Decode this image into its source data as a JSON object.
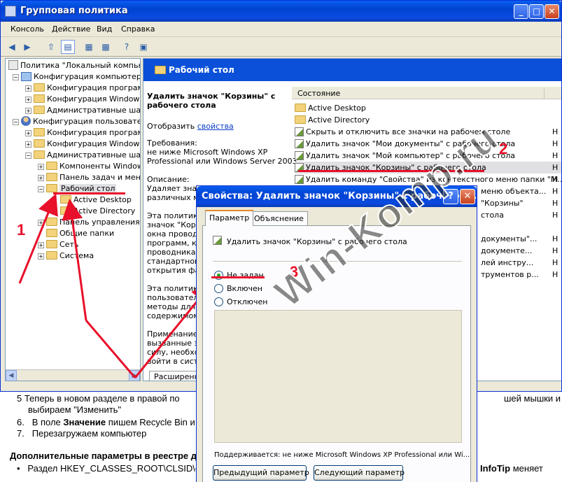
{
  "window": {
    "title": "Групповая политика",
    "menu": [
      "Консоль",
      "Действие",
      "Вид",
      "Справка"
    ],
    "controls": {
      "minimize": "_",
      "maximize": "□",
      "close": "✕"
    }
  },
  "tree": {
    "root": "Политика \"Локальный компьюте",
    "computer_config": "Конфигурация компьютера",
    "computer_children": [
      "Конфигурация программ",
      "Конфигурация Windows",
      "Административные шабл"
    ],
    "user_config": "Конфигурация пользователя",
    "user_children": [
      "Конфигурация программ",
      "Конфигурация Windows",
      "Административные шабл"
    ],
    "admin_children": [
      "Компоненты Windows",
      "Панель задач и меню",
      "Рабочий стол"
    ],
    "desktop_children": [
      "Active Desktop",
      "Active Directory"
    ],
    "admin_rest": [
      "Панель управления",
      "Общие папки",
      "Сеть",
      "Система"
    ]
  },
  "right": {
    "header": "Рабочий стол",
    "desc_title_1": "Удалить значок \"Корзины\" с",
    "desc_title_2": "рабочего стола",
    "show_prefix": "Отобразить",
    "show_link": "свойства",
    "req_label": "Требования:",
    "req_1": "не ниже Microsoft Windows XP",
    "req_2": "Professional или Windows Server 2003",
    "desc_label": "Описание:",
    "desc_1": "Удаляет значок",
    "desc_2": "различных ме",
    "p3_1": "Эта политика",
    "p3_2": "значок \"Корзи",
    "p3_3": "окна проводни",
    "p3_4": "программ, кот",
    "p3_5": "проводника W",
    "p3_6": "стандартного",
    "p3_7": "открытия фай",
    "p4_1": "Эта политика",
    "p4_2": "пользователя",
    "p4_3": "методы для п",
    "p4_4": "содержимому",
    "p5_1": "Применание: ч",
    "p5_2": "вызванные эт",
    "p5_3": "силу, необхо",
    "p5_4": "войти в систе",
    "col_state": "Состояние",
    "folders": [
      "Active Desktop",
      "Active Directory"
    ],
    "policies": [
      "Скрыть и отключить все значки на рабочем столе",
      "Удалить значок \"Мои документы\" с рабочего стола",
      "Удалить значок \"Мой компьютер\" с рабочего стола",
      "Удалить значок \"Корзины\" с рабочего стола",
      "Удалить команду \"Свойства\" из контекстного меню папки \"М..."
    ],
    "state_h": "Н",
    "bottom_tab": "Расширенный",
    "behind_rows": [
      "меню объекта...",
      "\"Корзины\"",
      "стола",
      "документы\"...",
      "документе...",
      "лей инстру...",
      "трументов р..."
    ]
  },
  "dialog": {
    "title": "Свойства: Удалить значок \"Корзины\" с рабочего ст...",
    "help": "?",
    "close": "✕",
    "tabs": [
      "Параметр",
      "Объяснение"
    ],
    "setting_name": "Удалить значок \"Корзины\" с рабочего стола",
    "options": [
      "Не задан",
      "Включен",
      "Отключен"
    ],
    "supported": "Поддерживается:  не ниже Microsoft Windows XP Professional или Wi...",
    "prev": "Предыдущий параметр",
    "next": "Следующий параметр"
  },
  "article": {
    "l1": "5   Теперь в новом разделе в правой по",
    "l1b": "шей мышки и",
    "l2": "выбираем \"Изменить\"",
    "l3_num": "6.",
    "l3_a": "В поле ",
    "l3_b": "Значение",
    "l3_c": " пишем Recycle Bin и С",
    "l4_num": "7.",
    "l4": "Перезагружаем компьютер",
    "l5": "Дополнительные параметры в реестре д",
    "l6": "Раздел    HKEY_CLASSES_ROOT\\CLSID\\{64",
    "l6b": "InfoTip",
    "l6c": "меняет"
  },
  "annotations": {
    "n1": "1",
    "n2": "2",
    "n3": "3",
    "watermark": "Win-Komp.ru"
  },
  "colors": {
    "accent_red": "#e8102a",
    "title_blue": "#0a50d8"
  }
}
